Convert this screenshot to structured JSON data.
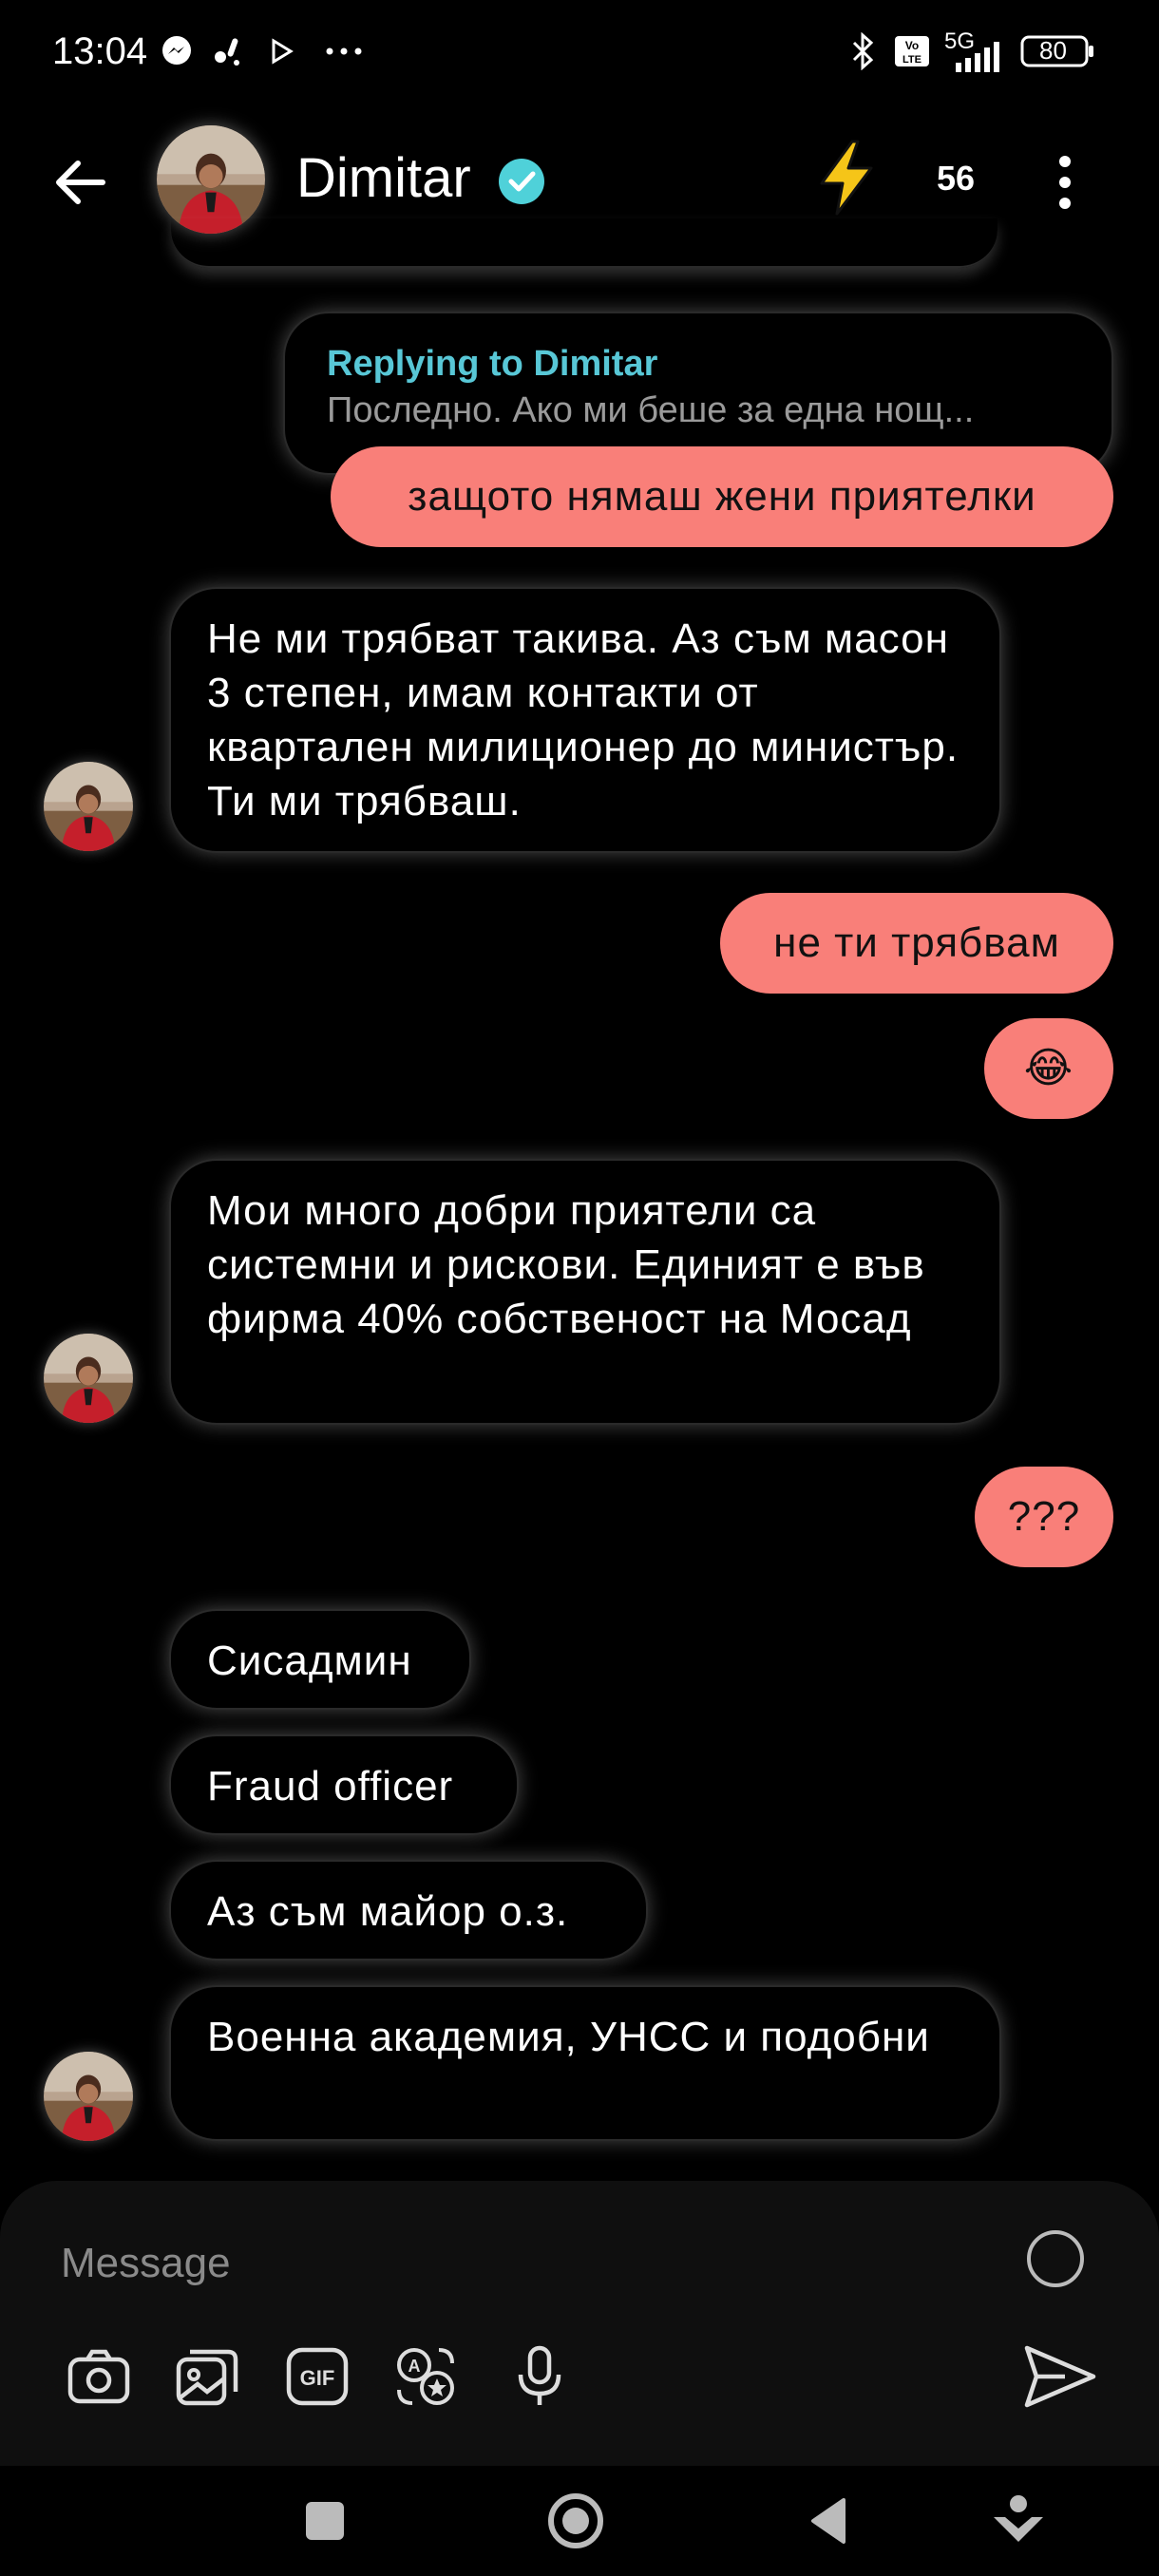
{
  "status_bar": {
    "time": "13:04",
    "network": "5G",
    "battery": "80"
  },
  "header": {
    "contact_name": "Dimitar",
    "streak_count": "56"
  },
  "reply": {
    "title": "Replying to Dimitar",
    "snippet": "Последно. Ако ми беше за една нощ..."
  },
  "messages": [
    {
      "from": "me",
      "text": "защото нямаш жени приятелки"
    },
    {
      "from": "them",
      "text": "Не ми трябват такива. Аз съм масон 3 степен, имам контакти от квартален милиционер до министър. Ти ми трябваш."
    },
    {
      "from": "me",
      "text": "не ти трябвам"
    },
    {
      "from": "me",
      "text": "😂"
    },
    {
      "from": "them",
      "text": "Мои много добри приятели са системни и рискови. Единият е във фирма 40% собственост на Мосад"
    },
    {
      "from": "me",
      "text": "???"
    },
    {
      "from": "them",
      "text": "Сисадмин"
    },
    {
      "from": "them",
      "text": "Fraud officer"
    },
    {
      "from": "them",
      "text": "Аз съм майор о.з."
    },
    {
      "from": "them",
      "text": "Военна академия, УНСС и подобни"
    }
  ],
  "composer": {
    "placeholder": "Message",
    "tools": [
      "camera-icon",
      "gallery-icon",
      "gif-icon",
      "sticker-icon",
      "microphone-icon"
    ],
    "send": "send-icon"
  },
  "colors": {
    "outgoing_bubble": "#f97f79",
    "reply_title": "#58c7d6",
    "verified_badge": "#4fd1d9",
    "bolt": "#f5c518"
  }
}
